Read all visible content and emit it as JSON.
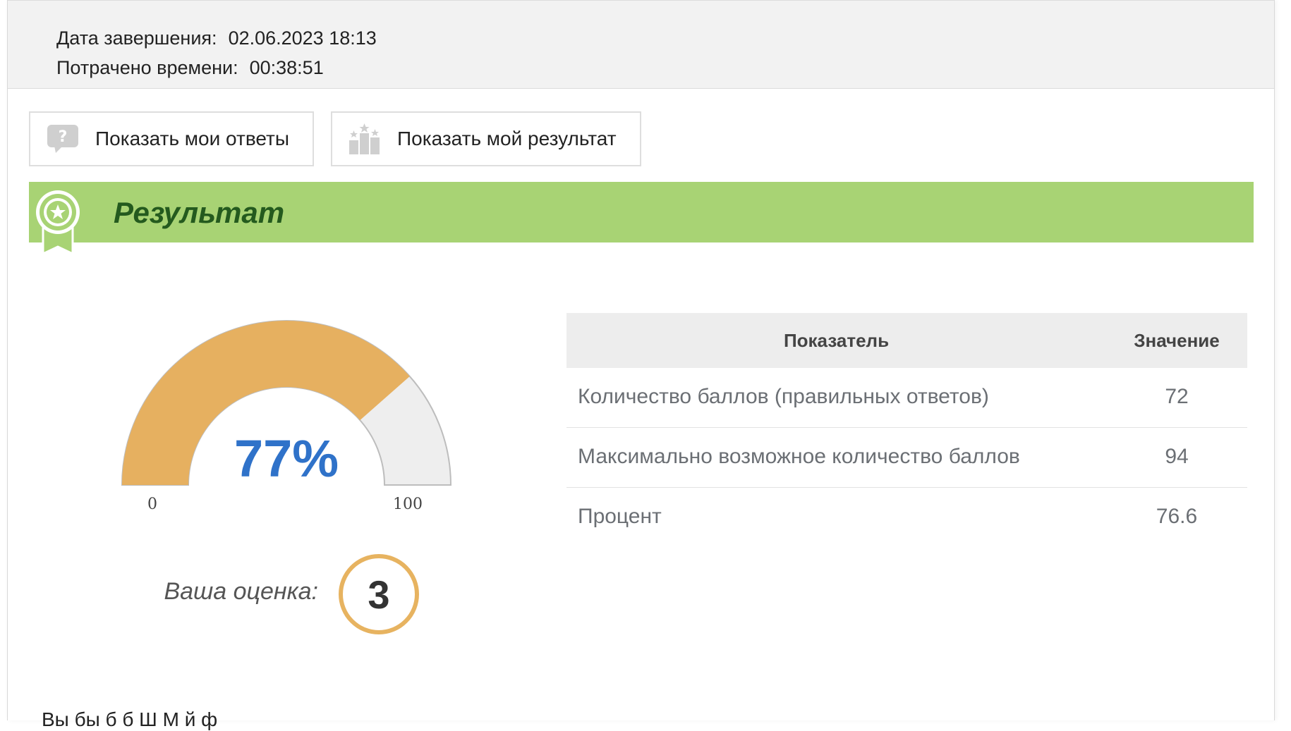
{
  "info": {
    "completion_label": "Дата завершения:",
    "completion_value": "02.06.2023 18:13",
    "time_label": "Потрачено времени:",
    "time_value": "00:38:51"
  },
  "buttons": {
    "show_answers": "Показать мои ответы",
    "show_result": "Показать мой результат"
  },
  "banner": {
    "title": "Результат"
  },
  "gauge": {
    "percent_label": "77%",
    "percent_value": 77,
    "min_label": "0",
    "max_label": "100",
    "fill_color": "#e6b060",
    "track_color": "#eeeeee"
  },
  "grade": {
    "label": "Ваша оценка:",
    "value": "3"
  },
  "table": {
    "headers": [
      "Показатель",
      "Значение"
    ],
    "rows": [
      {
        "name": "Количество баллов (правильных ответов)",
        "value": "72"
      },
      {
        "name": "Максимально возможное количество баллов",
        "value": "94"
      },
      {
        "name": "Процент",
        "value": "76.6"
      }
    ]
  },
  "footer": {
    "partial_text": "Вы                бы           б                         б                 Ш                                    М й                     ф"
  },
  "colors": {
    "banner": "#a8d374",
    "banner_text": "#245a1e",
    "accent_blue": "#2f72c9"
  }
}
